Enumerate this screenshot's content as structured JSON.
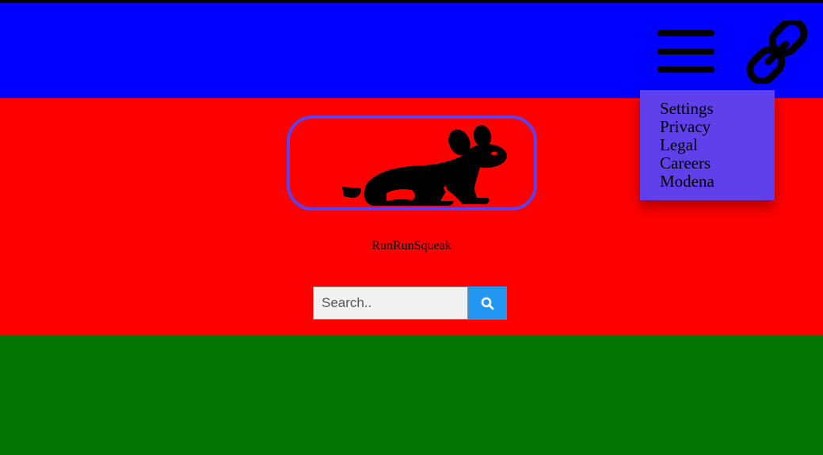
{
  "header": {
    "menu_icon": "hamburger-menu-icon",
    "link_icon": "link-icon",
    "background": "#0000ff"
  },
  "dropdown": {
    "items": [
      "Settings",
      "Privacy",
      "Legal",
      "Careers",
      "Modena"
    ],
    "background": "#6040ea"
  },
  "hero": {
    "logo_icon": "rabbit-icon",
    "brand_name": "RunRunSqueak",
    "background": "#ff0000"
  },
  "search": {
    "placeholder": "Search..",
    "button_icon": "search-icon",
    "button_color": "#2196f3"
  },
  "footer": {
    "background": "#047404"
  }
}
